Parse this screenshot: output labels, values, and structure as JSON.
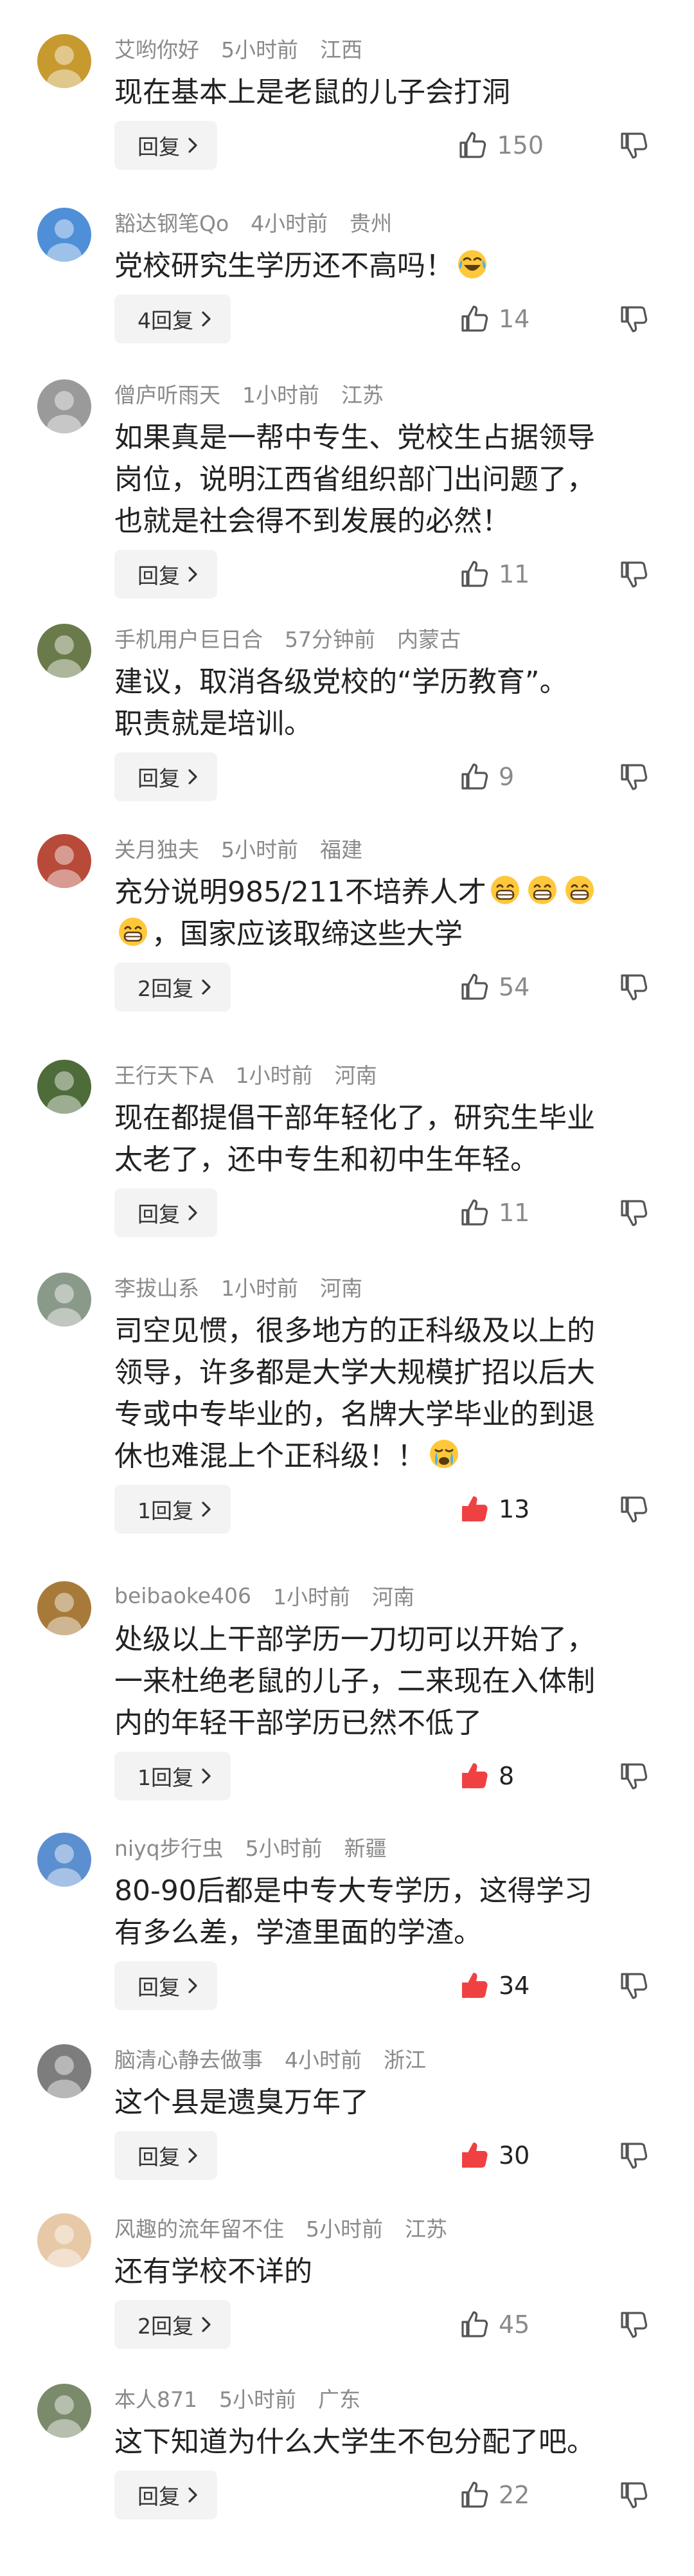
{
  "accent_color": "#f04142",
  "icons": {
    "like": "thumbs-up-icon",
    "dislike": "thumbs-down-icon",
    "reply_arrow": "chevron-right-icon"
  },
  "comments": [
    {
      "user": "艾哟你好",
      "time": "5小时前",
      "location": "江西",
      "avatar_color": "#c79a2f",
      "lines": [
        "现在基本上是老鼠的儿子会打洞"
      ],
      "reply_label": "回复",
      "likes": "150",
      "liked": false
    },
    {
      "user": "豁达钢笔Qo",
      "time": "4小时前",
      "location": "贵州",
      "avatar_color": "#4f8fd8",
      "lines": [
        "党校研究生学历还不高吗！[laugh-cry]"
      ],
      "reply_label": "4回复",
      "likes": "14",
      "liked": false
    },
    {
      "user": "僧庐听雨天",
      "time": "1小时前",
      "location": "江苏",
      "avatar_color": "#9a9a9a",
      "lines": [
        "如果真是一帮中专生、党校生占据领导",
        "岗位，说明江西省组织部门出问题了，",
        "也就是社会得不到发展的必然！"
      ],
      "reply_label": "回复",
      "likes": "11",
      "liked": false
    },
    {
      "user": "手机用户巨日合",
      "time": "57分钟前",
      "location": "内蒙古",
      "avatar_color": "#6b7a4a",
      "lines": [
        "建议，取消各级党校的“学历教育”。",
        "职责就是培训。"
      ],
      "reply_label": "回复",
      "likes": "9",
      "liked": false
    },
    {
      "user": "关月独夫",
      "time": "5小时前",
      "location": "福建",
      "avatar_color": "#b84a3a",
      "lines": [
        "充分说明985/211不培养人才[grin][grin][grin]",
        "[grin]，国家应该取缔这些大学"
      ],
      "reply_label": "2回复",
      "likes": "54",
      "liked": false
    },
    {
      "user": "王行天下A",
      "time": "1小时前",
      "location": "河南",
      "avatar_color": "#4e6b3a",
      "lines": [
        "现在都提倡干部年轻化了，研究生毕业",
        "太老了，还中专生和初中生年轻。"
      ],
      "reply_label": "回复",
      "likes": "11",
      "liked": false
    },
    {
      "user": "李拔山系",
      "time": "1小时前",
      "location": "河南",
      "avatar_color": "#8a9a8a",
      "lines": [
        "司空见惯，很多地方的正科级及以上的",
        "领导，许多都是大学大规模扩招以后大",
        "专或中专毕业的，名牌大学毕业的到退",
        "休也难混上个正科级！！[crying]"
      ],
      "reply_label": "1回复",
      "likes": "13",
      "liked": true
    },
    {
      "user": "beibaoke406",
      "time": "1小时前",
      "location": "河南",
      "avatar_color": "#a87a3a",
      "lines": [
        "处级以上干部学历一刀切可以开始了，",
        "一来杜绝老鼠的儿子，二来现在入体制",
        "内的年轻干部学历已然不低了"
      ],
      "reply_label": "1回复",
      "likes": "8",
      "liked": true
    },
    {
      "user": "niyq步行虫",
      "time": "5小时前",
      "location": "新疆",
      "avatar_color": "#5c8fd0",
      "lines": [
        "80-90后都是中专大专学历，这得学习",
        "有多么差，学渣里面的学渣。"
      ],
      "reply_label": "回复",
      "likes": "34",
      "liked": true
    },
    {
      "user": "脑清心静去做事",
      "time": "4小时前",
      "location": "浙江",
      "avatar_color": "#7d7d7d",
      "lines": [
        "这个县是遗臭万年了"
      ],
      "reply_label": "回复",
      "likes": "30",
      "liked": true
    },
    {
      "user": "风趣的流年留不住",
      "time": "5小时前",
      "location": "江苏",
      "avatar_color": "#e7c9a8",
      "lines": [
        "还有学校不详的"
      ],
      "reply_label": "2回复",
      "likes": "45",
      "liked": false
    },
    {
      "user": "本人871",
      "time": "5小时前",
      "location": "广东",
      "avatar_color": "#7a8a6a",
      "lines": [
        "这下知道为什么大学生不包分配了吧。"
      ],
      "reply_label": "回复",
      "likes": "22",
      "liked": false
    }
  ]
}
